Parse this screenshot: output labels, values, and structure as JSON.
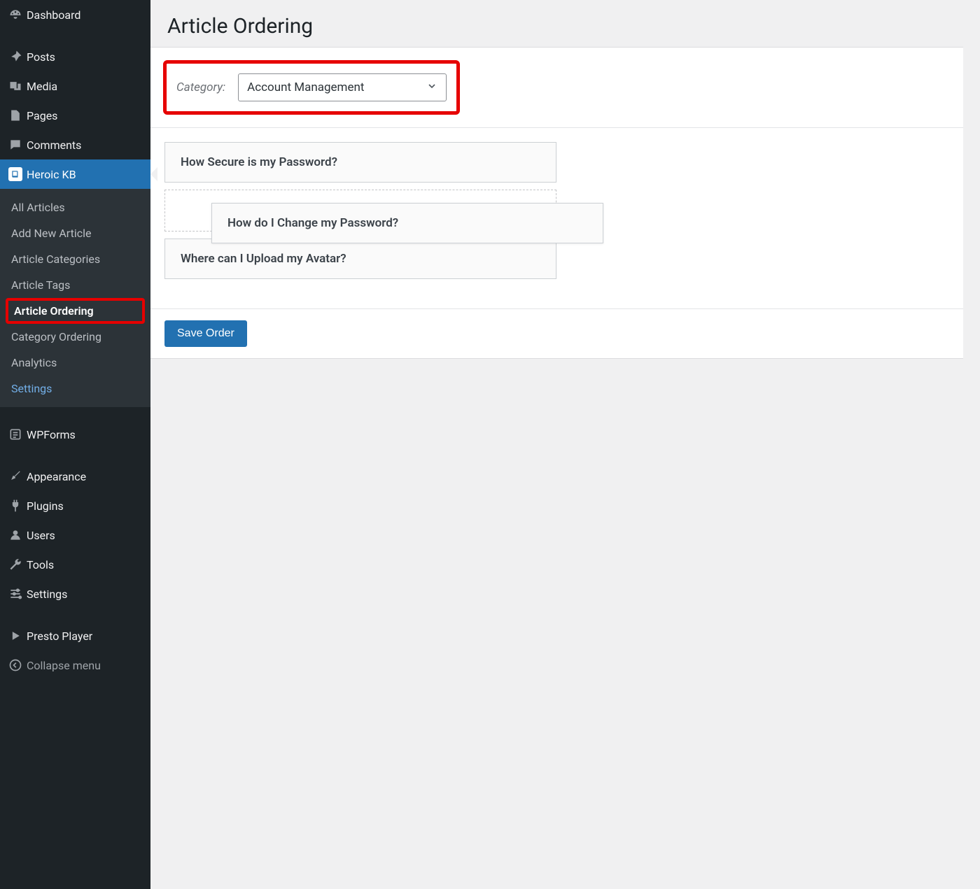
{
  "sidebar": {
    "dashboard": "Dashboard",
    "posts": "Posts",
    "media": "Media",
    "pages": "Pages",
    "comments": "Comments",
    "heroic": "Heroic KB",
    "submenu": {
      "all_articles": "All Articles",
      "add_new": "Add New Article",
      "categories": "Article Categories",
      "tags": "Article Tags",
      "ordering": "Article Ordering",
      "cat_ordering": "Category Ordering",
      "analytics": "Analytics",
      "settings": "Settings"
    },
    "wpforms": "WPForms",
    "appearance": "Appearance",
    "plugins": "Plugins",
    "users": "Users",
    "tools": "Tools",
    "admin_settings": "Settings",
    "presto": "Presto Player",
    "collapse": "Collapse menu"
  },
  "main": {
    "title": "Article Ordering",
    "category_label": "Category:",
    "category_selected": "Account Management",
    "articles": {
      "first": "How Secure is my Password?",
      "dragging": "How do I Change my Password?",
      "last": "Where can I Upload my Avatar?"
    },
    "save_label": "Save Order"
  }
}
